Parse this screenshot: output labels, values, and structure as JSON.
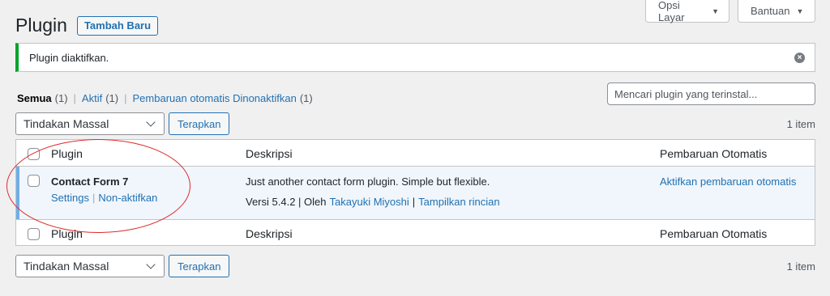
{
  "screen_meta": {
    "screen_options_label": "Opsi Layar",
    "help_label": "Bantuan"
  },
  "header": {
    "title": "Plugin",
    "add_new_label": "Tambah Baru"
  },
  "notice": {
    "message": "Plugin diaktifkan.",
    "dismiss_icon": "×"
  },
  "filters": {
    "all_label": "Semua",
    "all_count": "(1)",
    "active_label": "Aktif",
    "active_count": "(1)",
    "auto_off_label": "Pembaruan otomatis Dinonaktifkan",
    "auto_off_count": "(1)",
    "separator": "|"
  },
  "search": {
    "placeholder": "Mencari plugin yang terinstal..."
  },
  "tablenav": {
    "bulk_action_label": "Tindakan Massal",
    "apply_label": "Terapkan",
    "item_count": "1 item"
  },
  "table": {
    "columns": [
      "Plugin",
      "Deskripsi",
      "Pembaruan Otomatis"
    ],
    "plugins": [
      {
        "name": "Contact Form 7",
        "actions": [
          "Settings",
          "Non-aktifkan"
        ],
        "description": "Just another contact form plugin. Simple but flexible.",
        "version_text": "Versi 5.4.2 | Oleh",
        "author": "Takayuki Miyoshi",
        "details_link": "Tampilkan rincian",
        "auto_update_link": "Aktifkan pembaruan otomatis"
      }
    ]
  },
  "colors": {
    "accent": "#2271b1",
    "notice_success": "#00a32a",
    "active_row_border": "#72aee6",
    "annotation": "#e02b2b"
  }
}
